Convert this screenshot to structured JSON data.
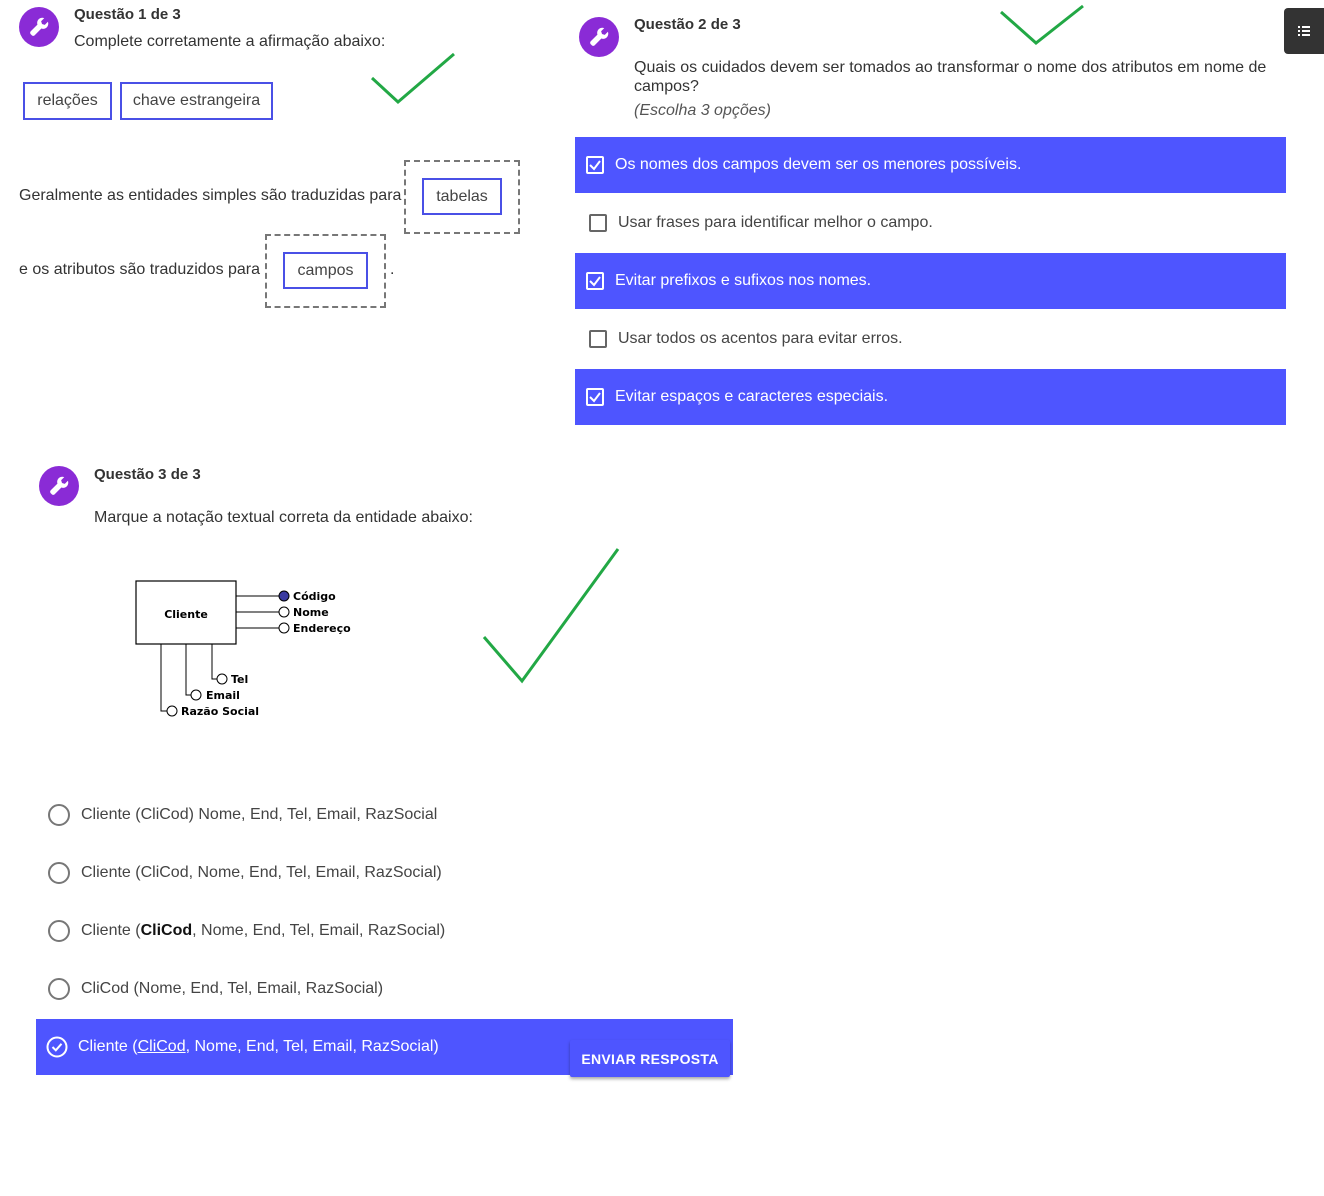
{
  "q1": {
    "title": "Questão 1 de 3",
    "prompt": "Complete corretamente a afirmação abaixo:",
    "chips": [
      "relações",
      "chave estrangeira"
    ],
    "line1_text": "Geralmente as entidades simples são traduzidas para",
    "line1_answer": "tabelas",
    "line2_text": "e os atributos são traduzidos para",
    "line2_answer": "campos",
    "line2_end": "."
  },
  "q2": {
    "title": "Questão 2 de 3",
    "prompt": "Quais os cuidados devem ser tomados ao transformar o nome dos atributos em nome de campos?",
    "hint": "(Escolha 3 opções)",
    "options": [
      {
        "label": "Os nomes dos campos devem ser os menores possíveis.",
        "checked": true
      },
      {
        "label": "Usar frases para identificar melhor o campo.",
        "checked": false
      },
      {
        "label": "Evitar prefixos e sufixos nos nomes.",
        "checked": true
      },
      {
        "label": "Usar todos os acentos para evitar erros.",
        "checked": false
      },
      {
        "label": "Evitar espaços e caracteres especiais.",
        "checked": true
      }
    ]
  },
  "q3": {
    "title": "Questão 3 de 3",
    "prompt": "Marque a notação textual correta da entidade abaixo:",
    "diagram": {
      "entity": "Cliente",
      "attributes": [
        "Código",
        "Nome",
        "Endereço",
        "Tel",
        "Email",
        "Razão Social"
      ]
    },
    "options": [
      {
        "label": "Cliente (CliCod) Nome, End, Tel, Email, RazSocial",
        "selected": false
      },
      {
        "label": "Cliente (CliCod, Nome, End, Tel, Email, RazSocial)",
        "selected": false
      },
      {
        "pre": "Cliente (",
        "bold": "CliCod",
        "post": ", Nome, End, Tel, Email, RazSocial)",
        "selected": false
      },
      {
        "label": "CliCod (Nome, End, Tel, Email, RazSocial)",
        "selected": false
      },
      {
        "pre": "Cliente (",
        "underline": "CliCod",
        "post": ", Nome, End, Tel, Email, RazSocial)",
        "selected": true
      }
    ],
    "submit_label": "ENVIAR RESPOSTA"
  },
  "colors": {
    "accent": "#4e55ff",
    "icon_bg": "#8a2bd6",
    "checkmark": "#22a845",
    "chip_border": "#4a50e6"
  },
  "icons": {
    "question": "wrench-icon",
    "side": "list-icon",
    "annotation": "checkmark-icon"
  }
}
